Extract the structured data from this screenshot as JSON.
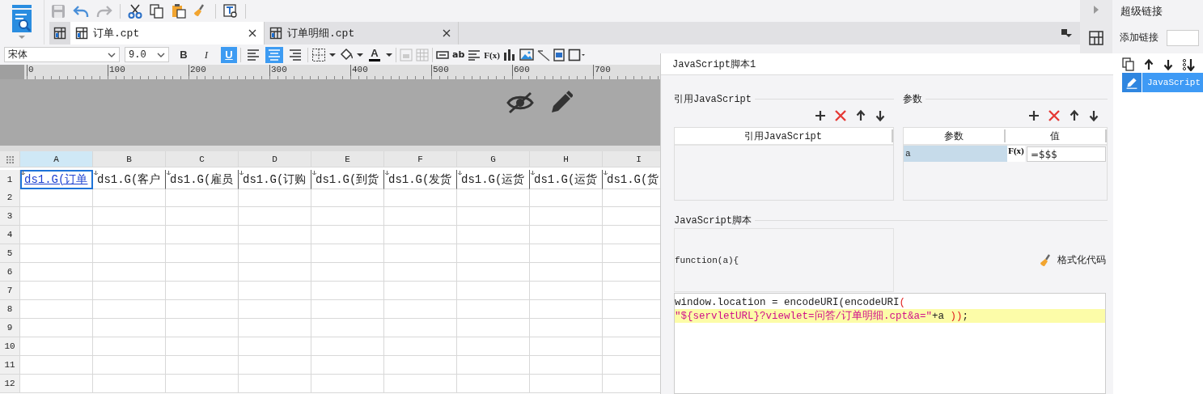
{
  "toolbar": {
    "file_tabs": [
      {
        "label": "订单.cpt",
        "selected": true
      },
      {
        "label": "订单明细.cpt",
        "selected": false
      }
    ]
  },
  "format_bar": {
    "font": "宋体",
    "size": "9.0",
    "styles": [
      {
        "kind": "bold",
        "label": "B",
        "selected": false
      },
      {
        "kind": "italic",
        "label": "I",
        "selected": false
      },
      {
        "kind": "underline",
        "label": "U",
        "selected": true
      }
    ],
    "align": [
      {
        "kind": "left",
        "selected": false
      },
      {
        "kind": "center",
        "selected": true
      },
      {
        "kind": "right",
        "selected": false
      }
    ],
    "font_color": "A",
    "tools": [
      {
        "kind": "text-field"
      },
      {
        "kind": "text",
        "label": "ab"
      },
      {
        "kind": "lines"
      },
      {
        "kind": "formula",
        "label": "F(x)"
      },
      {
        "kind": "chart"
      },
      {
        "kind": "image"
      },
      {
        "kind": "slash"
      },
      {
        "kind": "subreport"
      },
      {
        "kind": "border"
      }
    ]
  },
  "ruler": {
    "ticks": [
      "0",
      "100",
      "200",
      "300",
      "400",
      "500",
      "600",
      "700"
    ]
  },
  "sheet": {
    "columns": [
      {
        "label": "A",
        "selected": true
      },
      {
        "label": "B",
        "selected": false
      },
      {
        "label": "C",
        "selected": false
      },
      {
        "label": "D",
        "selected": false
      },
      {
        "label": "E",
        "selected": false
      },
      {
        "label": "F",
        "selected": false
      },
      {
        "label": "G",
        "selected": false
      },
      {
        "label": "H",
        "selected": false
      },
      {
        "label": "I",
        "selected": false
      }
    ],
    "rows": [
      "1",
      "2",
      "3",
      "4",
      "5",
      "6",
      "7",
      "8",
      "9",
      "10",
      "11",
      "12"
    ],
    "cells": [
      {
        "text": "ds1.G(订单",
        "selected": true
      },
      {
        "text": "ds1.G(客户",
        "selected": false
      },
      {
        "text": "ds1.G(雇员",
        "selected": false
      },
      {
        "text": "ds1.G(订购",
        "selected": false
      },
      {
        "text": "ds1.G(到货",
        "selected": false
      },
      {
        "text": "ds1.G(发货",
        "selected": false
      },
      {
        "text": "ds1.G(运货",
        "selected": false
      },
      {
        "text": "ds1.G(运货",
        "selected": false
      },
      {
        "text": "ds1.G(货",
        "selected": false
      }
    ]
  },
  "side_panel": {
    "title": "超级链接",
    "add_label": "添加链接",
    "links": [
      {
        "label": "JavaScript",
        "selected": true
      }
    ]
  },
  "dialog": {
    "title": "JavaScript脚本1",
    "ref_section": {
      "title": "引用JavaScript",
      "column": "引用JavaScript"
    },
    "params_section": {
      "title": "参数",
      "columns": [
        "参数",
        "值"
      ],
      "rows": [
        {
          "name": "a",
          "formula": "F(x)",
          "value": "=$$$"
        }
      ]
    },
    "script_section": {
      "title": "JavaScript脚本",
      "header": "function(a){",
      "format_button": "格式化代码",
      "code": [
        {
          "highlighted": false,
          "tokens": [
            {
              "kind": "plain",
              "text": "window.location = encodeURI(encodeURI"
            },
            {
              "kind": "paren",
              "text": "("
            }
          ]
        },
        {
          "highlighted": true,
          "tokens": [
            {
              "kind": "string",
              "text": "\"${servletURL}?viewlet=问答/订单明细.cpt&a=\""
            },
            {
              "kind": "plain",
              "text": "+a "
            },
            {
              "kind": "paren",
              "text": "))"
            },
            {
              "kind": "plain",
              "text": ";"
            }
          ]
        }
      ]
    }
  }
}
